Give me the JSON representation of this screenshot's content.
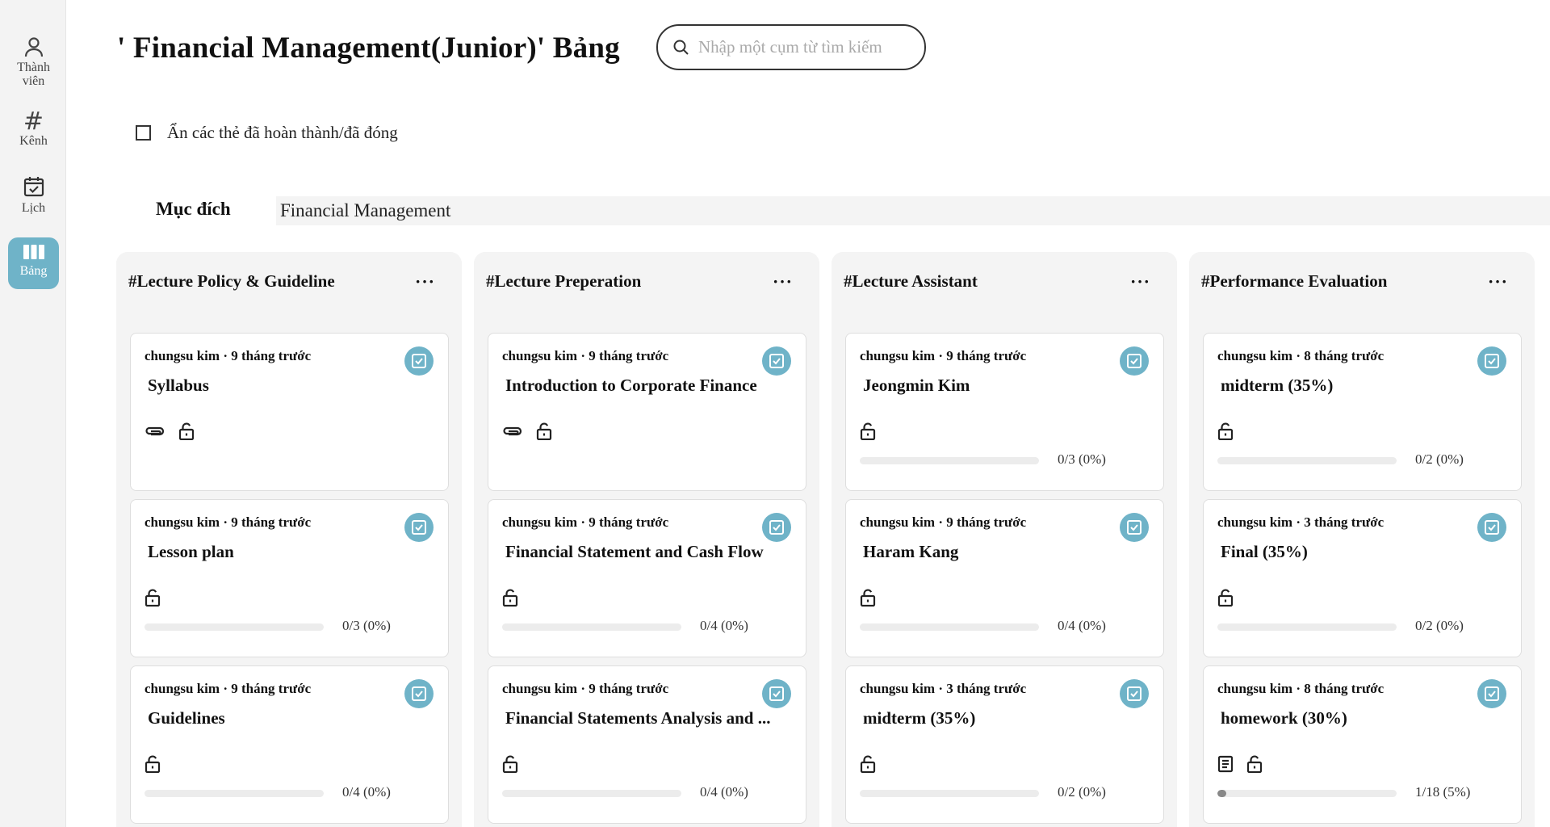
{
  "sidebar": {
    "items": [
      {
        "label_line1": "Thành",
        "label_line2": "viên",
        "icon": "person-icon"
      },
      {
        "label": "Kênh",
        "icon": "hash-icon"
      },
      {
        "label": "Lịch",
        "icon": "calendar-icon"
      },
      {
        "label": "Bảng",
        "icon": "board-icon",
        "active": true
      }
    ]
  },
  "header": {
    "title": "' Financial Management(Junior)' Bảng",
    "search_placeholder": "Nhập một cụm từ tìm kiếm"
  },
  "hide_completed_label": "Ẩn các thẻ đã hoàn thành/đã đóng",
  "purpose": {
    "label": "Mục đích",
    "value": "Financial Management"
  },
  "accent_color": "#6fb3c8",
  "columns": [
    {
      "title": "#Lecture Policy & Guideline",
      "more": "···",
      "cards": [
        {
          "meta": "chungsu kim · 9 tháng trước",
          "title": "Syllabus",
          "icons": [
            "paperclip-icon",
            "unlock-icon"
          ],
          "progress": null
        },
        {
          "meta": "chungsu kim · 9 tháng trước",
          "title": "Lesson plan",
          "icons": [
            "unlock-icon"
          ],
          "progress": {
            "text": "0/3 (0%)",
            "fraction": 0
          }
        },
        {
          "meta": "chungsu kim · 9 tháng trước",
          "title": "Guidelines",
          "icons": [
            "unlock-icon"
          ],
          "progress": {
            "text": "0/4 (0%)",
            "fraction": 0
          }
        }
      ]
    },
    {
      "title": "#Lecture Preperation",
      "more": "···",
      "cards": [
        {
          "meta": "chungsu kim · 9 tháng trước",
          "title": "Introduction to Corporate Finance",
          "icons": [
            "paperclip-icon",
            "unlock-icon"
          ],
          "progress": null
        },
        {
          "meta": "chungsu kim · 9 tháng trước",
          "title": "Financial Statement and Cash Flow",
          "icons": [
            "unlock-icon"
          ],
          "progress": {
            "text": "0/4 (0%)",
            "fraction": 0
          }
        },
        {
          "meta": "chungsu kim · 9 tháng trước",
          "title": "Financial Statements Analysis and ...",
          "icons": [
            "unlock-icon"
          ],
          "progress": {
            "text": "0/4 (0%)",
            "fraction": 0
          }
        }
      ]
    },
    {
      "title": "#Lecture Assistant",
      "more": "···",
      "cards": [
        {
          "meta": "chungsu kim · 9 tháng trước",
          "title": "Jeongmin Kim",
          "icons": [
            "unlock-icon"
          ],
          "progress": {
            "text": "0/3 (0%)",
            "fraction": 0
          }
        },
        {
          "meta": "chungsu kim · 9 tháng trước",
          "title": "Haram Kang",
          "icons": [
            "unlock-icon"
          ],
          "progress": {
            "text": "0/4 (0%)",
            "fraction": 0
          }
        },
        {
          "meta": "chungsu kim · 3 tháng trước",
          "title": "midterm (35%)",
          "icons": [
            "unlock-icon"
          ],
          "progress": {
            "text": "0/2 (0%)",
            "fraction": 0
          }
        }
      ]
    },
    {
      "title": "#Performance Evaluation",
      "more": "···",
      "cards": [
        {
          "meta": "chungsu kim · 8 tháng trước",
          "title": "midterm (35%)",
          "icons": [
            "unlock-icon"
          ],
          "progress": {
            "text": "0/2 (0%)",
            "fraction": 0
          }
        },
        {
          "meta": "chungsu kim · 3 tháng trước",
          "title": "Final (35%)",
          "icons": [
            "unlock-icon"
          ],
          "progress": {
            "text": "0/2 (0%)",
            "fraction": 0
          }
        },
        {
          "meta": "chungsu kim · 8 tháng trước",
          "title": "homework (30%)",
          "icons": [
            "document-icon",
            "unlock-icon"
          ],
          "progress": {
            "text": "1/18 (5%)",
            "fraction": 0.05
          }
        }
      ]
    }
  ]
}
